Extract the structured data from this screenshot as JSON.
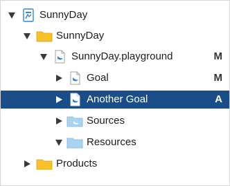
{
  "navigator": {
    "items": [
      {
        "label": "SunnyDay",
        "status": ""
      },
      {
        "label": "SunnyDay",
        "status": ""
      },
      {
        "label": "SunnyDay.playground",
        "status": "M"
      },
      {
        "label": "Goal",
        "status": "M"
      },
      {
        "label": "Another Goal",
        "status": "A"
      },
      {
        "label": "Sources",
        "status": ""
      },
      {
        "label": "Resources",
        "status": ""
      },
      {
        "label": "Products",
        "status": ""
      }
    ]
  },
  "colors": {
    "selection": "#1b4e88",
    "folder_yellow": "#f6c12a",
    "folder_blue": "#a9d3f0",
    "swift_blue": "#2f86d8"
  }
}
